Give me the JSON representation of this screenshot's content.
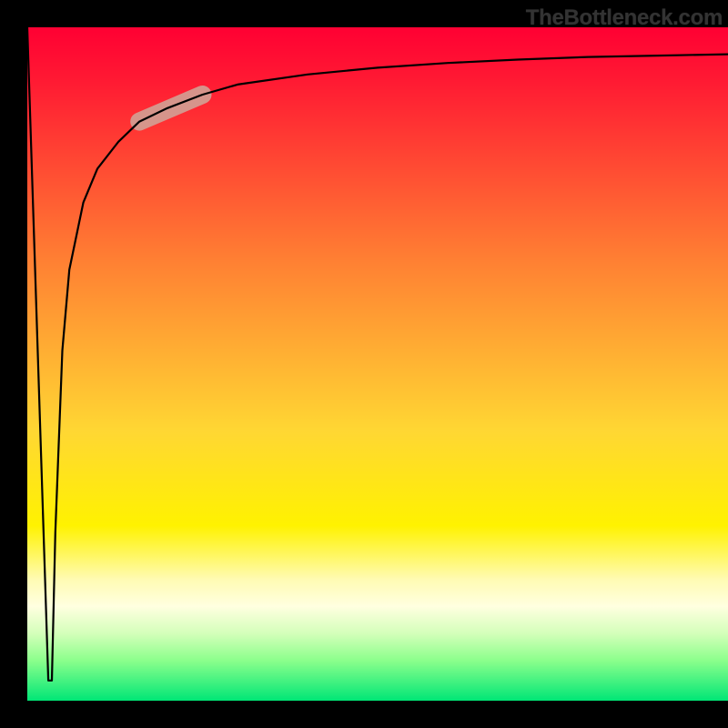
{
  "watermark": "TheBottleneck.com",
  "colors": {
    "gradient_top": "#ff0033",
    "gradient_mid_upper": "#ff8133",
    "gradient_mid": "#ffd733",
    "gradient_mid_lower": "#fff200",
    "gradient_bottom": "#00e676",
    "curve": "#000000",
    "highlight": "#d29e92",
    "frame": "#000000"
  },
  "chart_data": {
    "type": "line",
    "title": "",
    "xlabel": "",
    "ylabel": "",
    "xlim_note": "axes hidden / unlabeled",
    "ylim_note": "axes hidden / unlabeled",
    "series": [
      {
        "name": "bottleneck-curve",
        "x": [
          0.0,
          0.03,
          0.035,
          0.04,
          0.05,
          0.06,
          0.08,
          0.1,
          0.13,
          0.16,
          0.2,
          0.25,
          0.3,
          0.4,
          0.5,
          0.6,
          0.7,
          0.8,
          0.9,
          1.0
        ],
        "y": [
          1.0,
          0.03,
          0.03,
          0.25,
          0.52,
          0.64,
          0.74,
          0.79,
          0.83,
          0.86,
          0.88,
          0.9,
          0.915,
          0.93,
          0.94,
          0.947,
          0.952,
          0.956,
          0.958,
          0.96
        ],
        "note": "normalized 0..1; sharp dip near x≈0.035 down to ~0.03 then rises toward ~0.96"
      }
    ],
    "annotations": [
      {
        "name": "highlight-segment",
        "x_range": [
          0.16,
          0.25
        ],
        "y_range": [
          0.86,
          0.9
        ],
        "style": "thick pale pill along curve"
      }
    ]
  }
}
